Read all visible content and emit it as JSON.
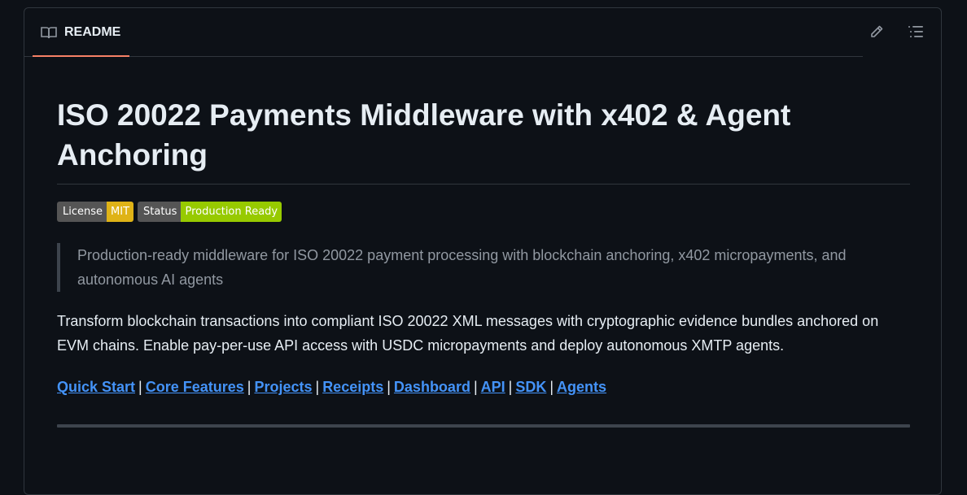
{
  "readme": {
    "tab_label": "README",
    "tab_icon": "book-icon",
    "actions": [
      {
        "name": "edit",
        "icon": "pencil-icon"
      },
      {
        "name": "outline",
        "icon": "list-icon"
      }
    ]
  },
  "content": {
    "title": "ISO 20022 Payments Middleware with x402 & Agent Anchoring",
    "badges": [
      {
        "label": "License",
        "value": "MIT",
        "color": "#dfb317"
      },
      {
        "label": "Status",
        "value": "Production Ready",
        "color": "#97ca00"
      }
    ],
    "quote": "Production-ready middleware for ISO 20022 payment processing with blockchain anchoring, x402 micropayments, and autonomous AI agents",
    "paragraph": "Transform blockchain transactions into compliant ISO 20022 XML messages with cryptographic evidence bundles anchored on EVM chains. Enable pay-per-use API access with USDC micropayments and deploy autonomous XMTP agents.",
    "links": [
      "Quick Start",
      "Core Features",
      "Projects",
      "Receipts",
      "Dashboard",
      "API",
      "SDK",
      "Agents"
    ],
    "link_separator": "|"
  },
  "colors": {
    "background": "#0d1117",
    "border": "#30363d",
    "link": "#4493f8",
    "tab_underline": "#f78166",
    "muted_text": "#9198a1"
  }
}
